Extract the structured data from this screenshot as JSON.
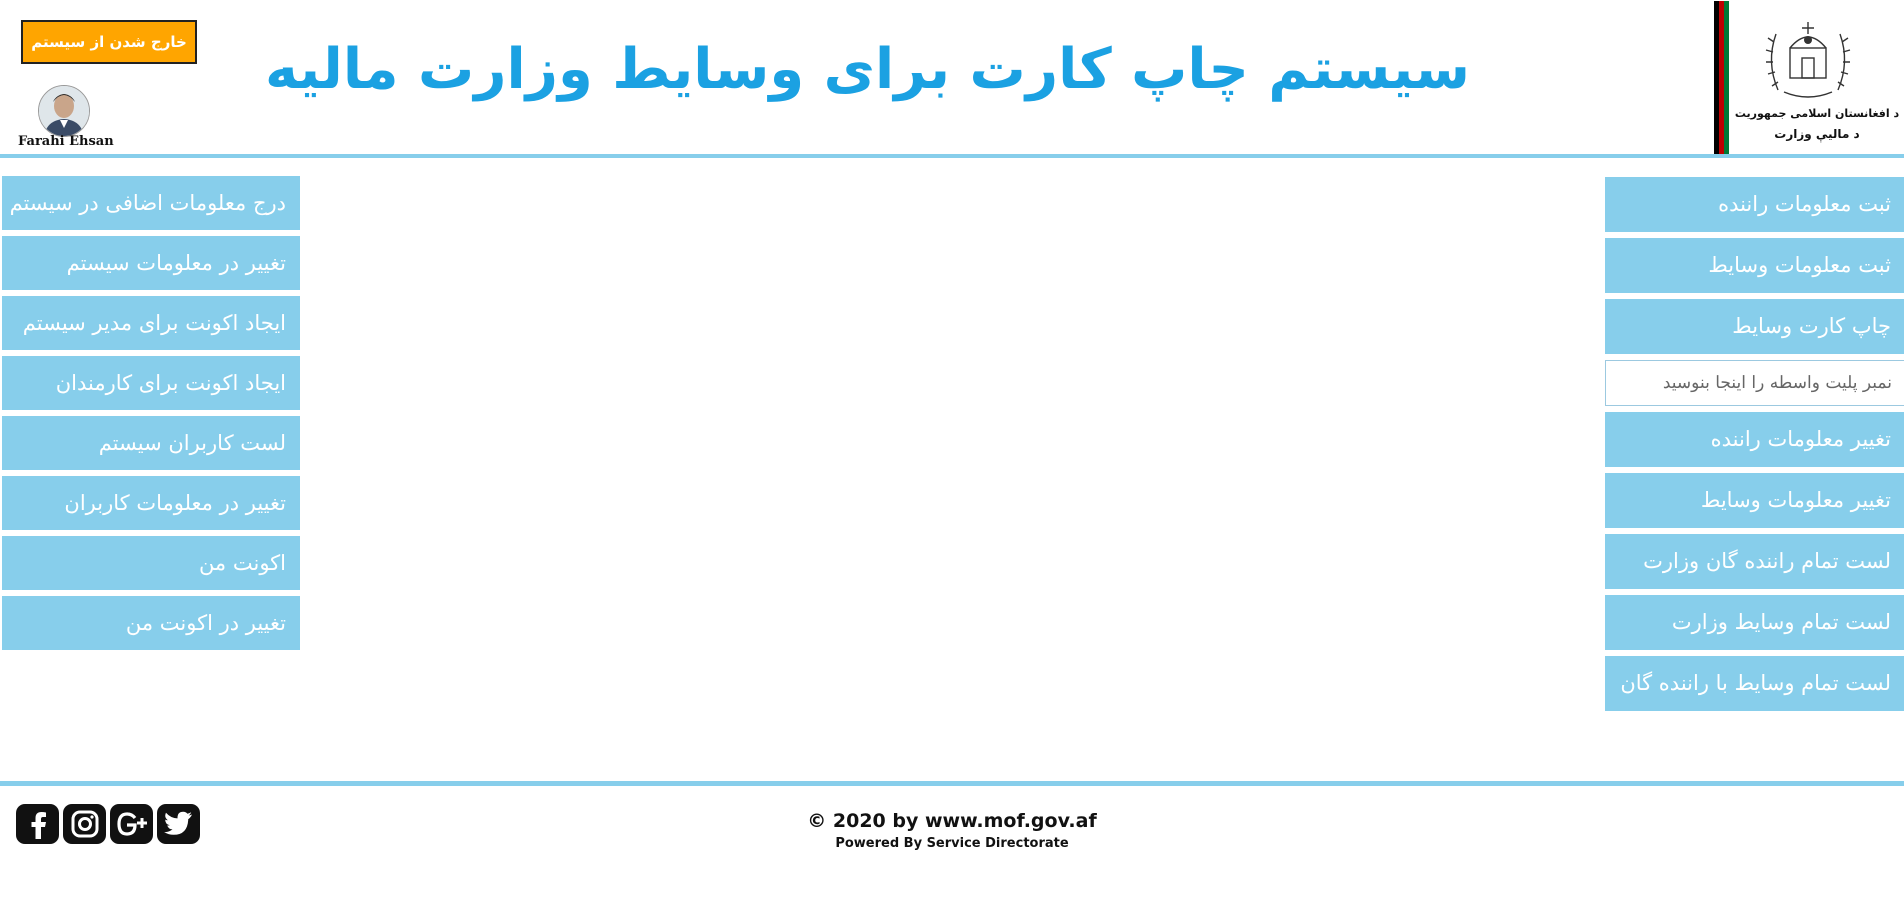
{
  "header": {
    "title": "سیستم چاپ کارت برای وسایط وزارت مالیه",
    "logout_label": "خارج شدن از سیستم",
    "user_name": "Farahi Ehsan",
    "ministry_line1": "د افغانستان اسلامی جمهوریت",
    "ministry_line2": "د مالیې وزارت"
  },
  "left_menu": {
    "items": [
      "درج معلومات اضافی در سیستم",
      "تغییر در معلومات سیستم",
      "ایجاد اکونت برای مدیر سیستم",
      "ایجاد اکونت برای کارمندان",
      "لست کاربران سیستم",
      "تغییر در معلومات کاربران",
      "اکونت من",
      "تغییر در اکونت من"
    ]
  },
  "right_menu": {
    "items_top": [
      "ثبت معلومات راننده",
      "ثبت معلومات وسایط",
      "چاپ کارت وسایط"
    ],
    "search_placeholder": "نمبر پلیت واسطه را اینجا بنوسید",
    "items_bottom": [
      "تغییر معلومات راننده",
      "تغییر معلومات وسایط",
      "لست تمام راننده گان وزارت",
      "لست تمام وسایط وزارت",
      "لست تمام وسایط با راننده گان"
    ]
  },
  "footer": {
    "copyright": "© 2020 by www.mof.gov.af",
    "powered_by": "Powered By Service Directorate",
    "social_icons": [
      "facebook-icon",
      "instagram-icon",
      "google-plus-icon",
      "twitter-icon"
    ]
  },
  "colors": {
    "accent": "#1BA1E2",
    "menu_bg": "#87CEEB",
    "logout_bg": "#FFA500",
    "flag": [
      "#000000",
      "#BE0000",
      "#007A36"
    ]
  }
}
